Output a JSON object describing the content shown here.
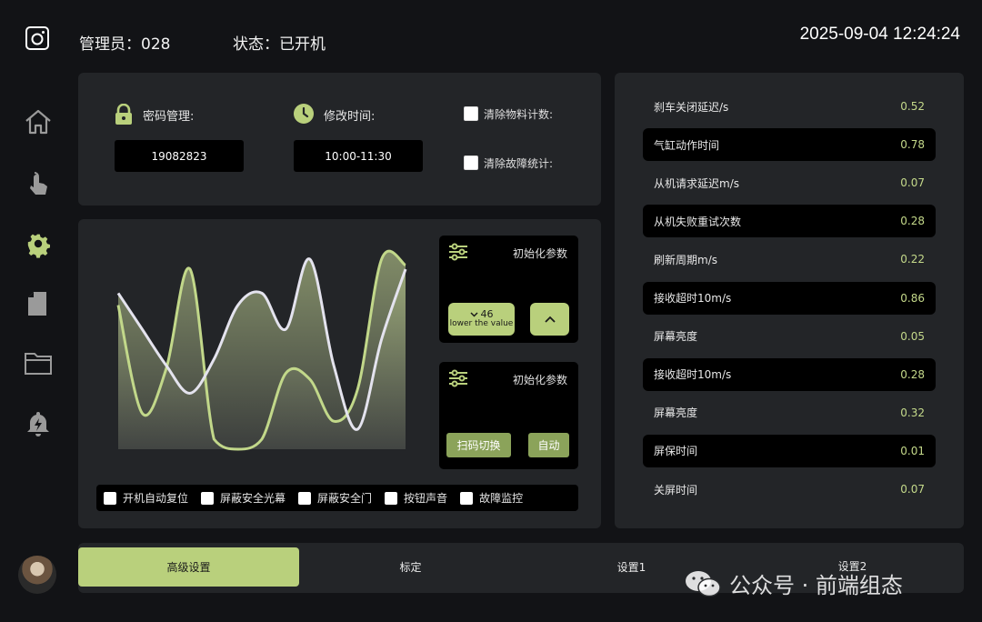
{
  "header": {
    "admin_label": "管理员：028",
    "status_label": "状态：已开机",
    "datetime": "2025-09-04 12:24:24"
  },
  "sidebar": {
    "items": [
      {
        "icon": "home-icon"
      },
      {
        "icon": "touch-icon"
      },
      {
        "icon": "gear-icon",
        "active": true
      },
      {
        "icon": "document-icon"
      },
      {
        "icon": "folder-icon"
      },
      {
        "icon": "alarm-icon"
      }
    ]
  },
  "settings": {
    "password": {
      "label": "密码管理:",
      "value": "19082823"
    },
    "modify_time": {
      "label": "修改时间:",
      "value": "10:00-11:30"
    },
    "clear_material": "清除物料计数:",
    "clear_fault": "清除故障统计:"
  },
  "chart_data": {
    "type": "area",
    "x": [
      0,
      1,
      2,
      3,
      4,
      5,
      6,
      7,
      8,
      9,
      10,
      11,
      12
    ],
    "series": [
      {
        "values": [
          0.78,
          0.6,
          0.42,
          0.28,
          0.45,
          0.72,
          0.78,
          0.6,
          0.95,
          0.42,
          0.1,
          0.55,
          0.9
        ]
      },
      {
        "values": [
          0.72,
          0.18,
          0.4,
          0.9,
          0.05,
          -0.05,
          0.05,
          0.38,
          0.35,
          0.14,
          0.3,
          0.95,
          0.92
        ]
      }
    ],
    "colors": {
      "series0_stroke": "#e4e3ee",
      "series1_stroke": "#c2d88a",
      "fill_top": "#aebd86",
      "fill_bottom": "#454845"
    },
    "grid": false,
    "legend": "none"
  },
  "controls": {
    "panel1": {
      "title": "初始化参数",
      "down_value": "46",
      "down_caption": "lower the value"
    },
    "panel2": {
      "title": "初始化参数",
      "scan_button": "扫码切换",
      "auto_button": "自动"
    }
  },
  "options": [
    "开机自动复位",
    "屏蔽安全光幕",
    "屏蔽安全门",
    "按钮声音",
    "故障监控"
  ],
  "params": [
    {
      "label": "刹车关闭延迟/s",
      "value": "0.52",
      "highlight": false
    },
    {
      "label": "气缸动作时间",
      "value": "0.78",
      "highlight": true
    },
    {
      "label": "从机请求延迟m/s",
      "value": "0.07",
      "highlight": false
    },
    {
      "label": "从机失败重试次数",
      "value": "0.28",
      "highlight": true
    },
    {
      "label": "刷新周期m/s",
      "value": "0.22",
      "highlight": false
    },
    {
      "label": "接收超时10m/s",
      "value": "0.86",
      "highlight": true
    },
    {
      "label": "屏幕亮度",
      "value": "0.05",
      "highlight": false
    },
    {
      "label": "接收超时10m/s",
      "value": "0.28",
      "highlight": true
    },
    {
      "label": "屏幕亮度",
      "value": "0.32",
      "highlight": false
    },
    {
      "label": "屏保时间",
      "value": "0.01",
      "highlight": true
    },
    {
      "label": "关屏时间",
      "value": "0.07",
      "highlight": false
    }
  ],
  "tabs": [
    {
      "label": "高级设置",
      "active": true
    },
    {
      "label": "标定",
      "active": false
    },
    {
      "label": "设置1",
      "active": false
    },
    {
      "label": "设置2",
      "active": false
    }
  ],
  "watermark": "公众号 · 前端组态",
  "theme": {
    "accent": "#b9d07c",
    "value_color": "#c4d98a",
    "panel_bg": "#232528",
    "page_bg": "#121316"
  }
}
